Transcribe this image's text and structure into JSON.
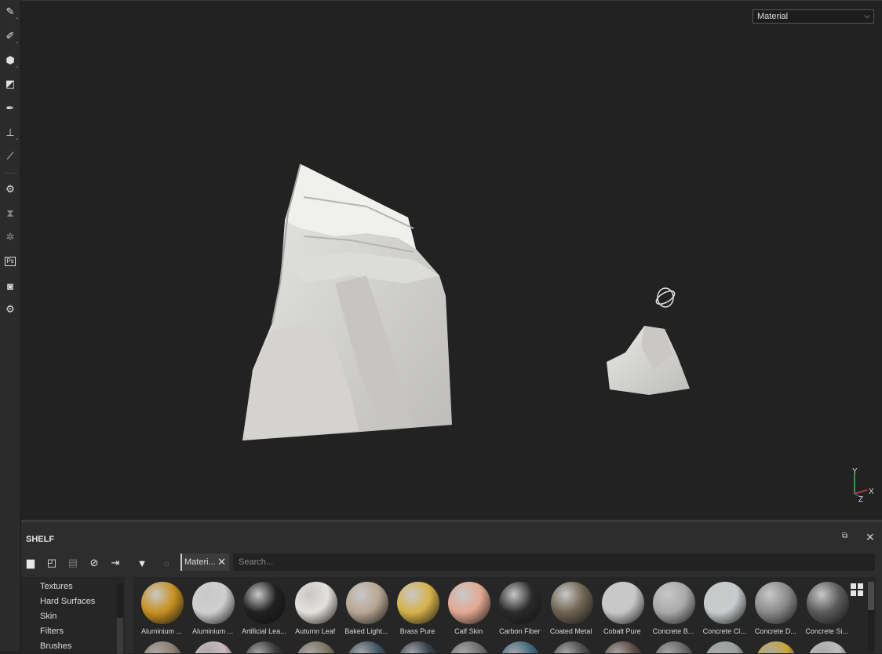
{
  "viewport": {
    "display_mode": "Material",
    "axes": {
      "y": "Y",
      "x": "X",
      "z": "Z"
    }
  },
  "toolbar": {
    "tools": [
      {
        "icon": "paint-brush-icon"
      },
      {
        "icon": "eraser-icon"
      },
      {
        "icon": "projection-icon"
      },
      {
        "icon": "polygon-fill-icon"
      },
      {
        "icon": "smudge-icon"
      },
      {
        "icon": "clone-stamp-icon"
      },
      {
        "icon": "color-picker-icon"
      },
      {
        "icon": "bake-icon"
      },
      {
        "icon": "hourglass-icon"
      },
      {
        "icon": "plugin-icon"
      },
      {
        "icon": "photoshop-icon",
        "text": "Ps"
      },
      {
        "icon": "render-icon"
      },
      {
        "icon": "settings-icon"
      }
    ]
  },
  "shelf": {
    "title": "SHELF",
    "filter_chip": "Materi...",
    "search_placeholder": "Search...",
    "categories": [
      "Textures",
      "Hard Surfaces",
      "Skin",
      "Filters",
      "Brushes"
    ],
    "materials": [
      {
        "name": "Aluminium ...",
        "color": "#c89020"
      },
      {
        "name": "Aluminium ...",
        "color": "#cfcfcf"
      },
      {
        "name": "Artificial Lea...",
        "color": "#202020"
      },
      {
        "name": "Autumn Leaf",
        "color": "#e4e0dc"
      },
      {
        "name": "Baked Light...",
        "color": "#b8a693"
      },
      {
        "name": "Brass Pure",
        "color": "#d6b24a"
      },
      {
        "name": "Calf Skin",
        "color": "#e2a890"
      },
      {
        "name": "Carbon Fiber",
        "color": "#2a2a2a"
      },
      {
        "name": "Coated Metal",
        "color": "#6d6350"
      },
      {
        "name": "Cobalt Pure",
        "color": "#c8c8c8"
      },
      {
        "name": "Concrete B...",
        "color": "#a9a9a9"
      },
      {
        "name": "Concrete Cl...",
        "color": "#c8cccc"
      },
      {
        "name": "Concrete D...",
        "color": "#8a8a8a"
      },
      {
        "name": "Concrete Si...",
        "color": "#5a5a5a"
      }
    ],
    "second_row_colors": [
      "#8c7e70",
      "#c9b8c0",
      "#3a3a3a",
      "#7c7460",
      "#3f5563",
      "#33404a",
      "#6d6d6d",
      "#3f6a80",
      "#4d4d4d",
      "#5e4a44",
      "#666666",
      "#9aa0a0",
      "#c9a73a",
      "#bdbdbd"
    ]
  }
}
